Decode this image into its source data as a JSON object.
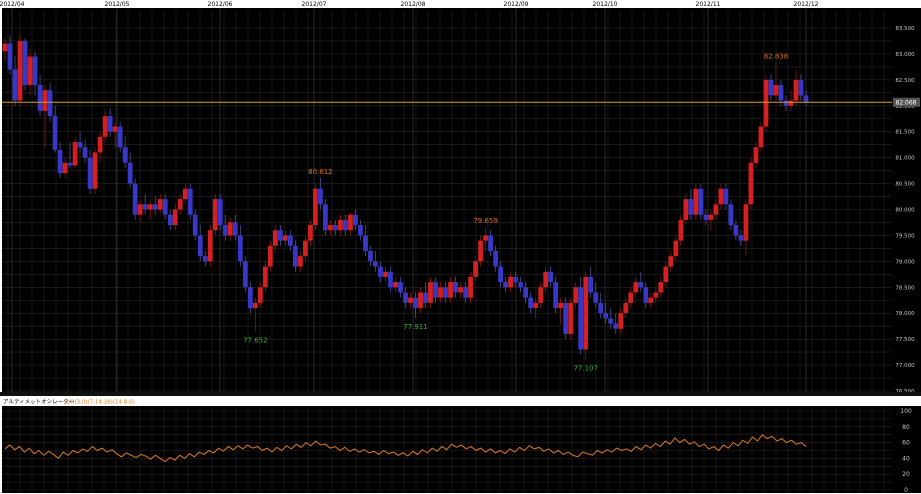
{
  "chart_data": [
    {
      "type": "candlestick",
      "x_labels": [
        "2012/04",
        "2012/05",
        "2012/06",
        "2012/07",
        "2012/08",
        "2012/09",
        "2012/10",
        "2012/11",
        "2012/12"
      ],
      "y_ticks": [
        "83.500",
        "83.000",
        "82.500",
        "82.000",
        "81.500",
        "81.000",
        "80.500",
        "80.000",
        "79.500",
        "79.000",
        "78.500",
        "78.000",
        "77.500",
        "77.000",
        "76.500"
      ],
      "ylim": [
        76.5,
        83.5
      ],
      "current_price": 82.068,
      "current_price_label": "82.068",
      "up_color": "#d42020",
      "down_color": "#3838c8",
      "line_color": "#d8a020",
      "annotations": [
        {
          "label": "77.652",
          "value": 77.652,
          "kind": "low",
          "color": "#30b030"
        },
        {
          "label": "80.612",
          "value": 80.612,
          "kind": "high",
          "color": "#e07020"
        },
        {
          "label": "77.911",
          "value": 77.911,
          "kind": "low",
          "color": "#30b030"
        },
        {
          "label": "79.659",
          "value": 79.659,
          "kind": "high",
          "color": "#e07020"
        },
        {
          "label": "77.107",
          "value": 77.107,
          "kind": "low",
          "color": "#30b030"
        },
        {
          "label": "82.838",
          "value": 82.838,
          "kind": "high",
          "color": "#e07020"
        }
      ],
      "candles": [
        [
          83.05,
          83.3,
          82.85,
          83.2
        ],
        [
          83.2,
          83.35,
          82.6,
          82.7
        ],
        [
          82.7,
          82.95,
          82.0,
          82.1
        ],
        [
          82.1,
          83.4,
          82.0,
          83.25
        ],
        [
          83.25,
          83.3,
          82.3,
          82.4
        ],
        [
          82.4,
          83.1,
          82.2,
          82.95
        ],
        [
          82.95,
          83.05,
          82.2,
          82.4
        ],
        [
          82.4,
          82.6,
          81.8,
          81.9
        ],
        [
          81.9,
          82.4,
          81.2,
          82.3
        ],
        [
          82.3,
          82.45,
          81.7,
          81.8
        ],
        [
          81.8,
          82.0,
          81.1,
          81.15
        ],
        [
          81.15,
          81.3,
          80.6,
          80.7
        ],
        [
          80.7,
          81.0,
          80.6,
          80.9
        ],
        [
          80.9,
          81.3,
          80.8,
          80.85
        ],
        [
          80.85,
          81.4,
          80.8,
          81.3
        ],
        [
          81.3,
          81.5,
          81.1,
          81.2
        ],
        [
          81.2,
          81.35,
          80.9,
          81.0
        ],
        [
          81.0,
          81.15,
          80.3,
          80.4
        ],
        [
          80.4,
          81.2,
          80.3,
          81.1
        ],
        [
          81.1,
          81.5,
          80.9,
          81.4
        ],
        [
          81.4,
          81.9,
          81.3,
          81.8
        ],
        [
          81.8,
          81.95,
          81.4,
          81.5
        ],
        [
          81.5,
          81.7,
          81.2,
          81.6
        ],
        [
          81.6,
          81.7,
          81.1,
          81.2
        ],
        [
          81.2,
          81.4,
          80.8,
          80.9
        ],
        [
          80.9,
          81.1,
          80.4,
          80.5
        ],
        [
          80.5,
          80.6,
          79.8,
          79.9
        ],
        [
          79.9,
          80.2,
          79.75,
          80.1
        ],
        [
          80.1,
          80.3,
          79.9,
          80.0
        ],
        [
          80.0,
          80.2,
          79.8,
          80.1
        ],
        [
          80.1,
          80.25,
          79.9,
          80.0
        ],
        [
          80.0,
          80.3,
          79.9,
          80.2
        ],
        [
          80.2,
          80.3,
          79.8,
          79.9
        ],
        [
          79.9,
          80.0,
          79.6,
          79.7
        ],
        [
          79.7,
          80.1,
          79.6,
          80.0
        ],
        [
          80.0,
          80.3,
          79.9,
          80.2
        ],
        [
          80.2,
          80.5,
          80.1,
          80.4
        ],
        [
          80.4,
          80.5,
          79.8,
          79.9
        ],
        [
          79.9,
          80.0,
          79.4,
          79.5
        ],
        [
          79.5,
          79.7,
          79.0,
          79.1
        ],
        [
          79.1,
          79.2,
          78.9,
          79.0
        ],
        [
          79.0,
          79.7,
          78.9,
          79.6
        ],
        [
          79.6,
          80.3,
          79.5,
          80.2
        ],
        [
          80.2,
          80.3,
          79.6,
          79.7
        ],
        [
          79.7,
          79.9,
          79.4,
          79.5
        ],
        [
          79.5,
          79.85,
          79.4,
          79.75
        ],
        [
          79.75,
          79.9,
          79.4,
          79.5
        ],
        [
          79.5,
          79.7,
          78.9,
          79.0
        ],
        [
          79.0,
          79.1,
          78.4,
          78.5
        ],
        [
          78.5,
          78.6,
          78.0,
          78.1
        ],
        [
          78.1,
          78.3,
          77.65,
          78.2
        ],
        [
          78.2,
          78.6,
          78.1,
          78.5
        ],
        [
          78.5,
          79.0,
          78.4,
          78.9
        ],
        [
          78.9,
          79.4,
          78.8,
          79.3
        ],
        [
          79.3,
          79.7,
          79.2,
          79.6
        ],
        [
          79.6,
          79.7,
          79.3,
          79.4
        ],
        [
          79.4,
          79.6,
          79.3,
          79.5
        ],
        [
          79.5,
          79.6,
          79.2,
          79.3
        ],
        [
          79.3,
          79.4,
          78.8,
          78.9
        ],
        [
          78.9,
          79.2,
          78.8,
          79.1
        ],
        [
          79.1,
          79.5,
          79.0,
          79.4
        ],
        [
          79.4,
          79.8,
          79.3,
          79.7
        ],
        [
          79.7,
          80.5,
          79.6,
          80.4
        ],
        [
          80.4,
          80.61,
          80.0,
          80.1
        ],
        [
          80.1,
          80.2,
          79.5,
          79.6
        ],
        [
          79.6,
          79.8,
          79.5,
          79.7
        ],
        [
          79.7,
          79.8,
          79.5,
          79.6
        ],
        [
          79.6,
          79.9,
          79.5,
          79.8
        ],
        [
          79.8,
          79.9,
          79.5,
          79.6
        ],
        [
          79.6,
          79.95,
          79.5,
          79.9
        ],
        [
          79.9,
          80.0,
          79.6,
          79.7
        ],
        [
          79.7,
          79.8,
          79.4,
          79.5
        ],
        [
          79.5,
          79.7,
          79.1,
          79.2
        ],
        [
          79.2,
          79.3,
          78.9,
          79.0
        ],
        [
          79.0,
          79.2,
          78.8,
          78.9
        ],
        [
          78.9,
          79.0,
          78.6,
          78.7
        ],
        [
          78.7,
          78.9,
          78.6,
          78.8
        ],
        [
          78.8,
          78.9,
          78.4,
          78.5
        ],
        [
          78.5,
          78.7,
          78.4,
          78.6
        ],
        [
          78.6,
          78.7,
          78.3,
          78.4
        ],
        [
          78.4,
          78.5,
          78.1,
          78.2
        ],
        [
          78.2,
          78.4,
          78.1,
          78.3
        ],
        [
          78.3,
          78.4,
          77.91,
          78.1
        ],
        [
          78.1,
          78.5,
          78.0,
          78.4
        ],
        [
          78.4,
          78.6,
          78.1,
          78.2
        ],
        [
          78.2,
          78.7,
          78.1,
          78.6
        ],
        [
          78.6,
          78.7,
          78.2,
          78.3
        ],
        [
          78.3,
          78.6,
          78.2,
          78.5
        ],
        [
          78.5,
          78.6,
          78.2,
          78.3
        ],
        [
          78.3,
          78.7,
          78.2,
          78.6
        ],
        [
          78.6,
          78.7,
          78.3,
          78.4
        ],
        [
          78.4,
          78.6,
          78.3,
          78.5
        ],
        [
          78.5,
          78.6,
          78.2,
          78.3
        ],
        [
          78.3,
          78.8,
          78.2,
          78.7
        ],
        [
          78.7,
          79.1,
          78.6,
          79.0
        ],
        [
          79.0,
          79.5,
          78.9,
          79.4
        ],
        [
          79.4,
          79.66,
          79.2,
          79.5
        ],
        [
          79.5,
          79.6,
          79.1,
          79.2
        ],
        [
          79.2,
          79.3,
          78.8,
          78.9
        ],
        [
          78.9,
          79.0,
          78.5,
          78.6
        ],
        [
          78.6,
          78.7,
          78.4,
          78.5
        ],
        [
          78.5,
          78.8,
          78.4,
          78.7
        ],
        [
          78.7,
          78.8,
          78.5,
          78.6
        ],
        [
          78.6,
          78.7,
          78.4,
          78.5
        ],
        [
          78.5,
          78.6,
          78.2,
          78.3
        ],
        [
          78.3,
          78.4,
          78.0,
          78.1
        ],
        [
          78.1,
          78.3,
          77.9,
          78.2
        ],
        [
          78.2,
          78.6,
          78.1,
          78.5
        ],
        [
          78.5,
          78.9,
          78.4,
          78.8
        ],
        [
          78.8,
          78.9,
          78.5,
          78.6
        ],
        [
          78.6,
          78.7,
          78.0,
          78.1
        ],
        [
          78.1,
          78.3,
          77.8,
          78.2
        ],
        [
          78.2,
          78.3,
          77.5,
          77.6
        ],
        [
          77.6,
          78.3,
          77.5,
          78.2
        ],
        [
          78.2,
          78.6,
          78.1,
          78.5
        ],
        [
          78.5,
          78.7,
          77.2,
          77.3
        ],
        [
          77.3,
          78.8,
          77.11,
          78.7
        ],
        [
          78.7,
          78.9,
          78.3,
          78.4
        ],
        [
          78.4,
          78.6,
          78.1,
          78.2
        ],
        [
          78.2,
          78.4,
          77.9,
          78.0
        ],
        [
          78.0,
          78.2,
          77.8,
          77.9
        ],
        [
          77.9,
          78.1,
          77.7,
          77.8
        ],
        [
          77.8,
          78.0,
          77.6,
          77.7
        ],
        [
          77.7,
          78.1,
          77.6,
          78.0
        ],
        [
          78.0,
          78.3,
          77.9,
          78.2
        ],
        [
          78.2,
          78.5,
          78.1,
          78.4
        ],
        [
          78.4,
          78.7,
          78.3,
          78.6
        ],
        [
          78.6,
          78.8,
          78.4,
          78.5
        ],
        [
          78.5,
          78.6,
          78.1,
          78.2
        ],
        [
          78.2,
          78.4,
          78.1,
          78.3
        ],
        [
          78.3,
          78.5,
          78.2,
          78.4
        ],
        [
          78.4,
          78.7,
          78.3,
          78.6
        ],
        [
          78.6,
          79.0,
          78.5,
          78.9
        ],
        [
          78.9,
          79.2,
          78.8,
          79.1
        ],
        [
          79.1,
          79.5,
          79.0,
          79.4
        ],
        [
          79.4,
          79.9,
          79.3,
          79.8
        ],
        [
          79.8,
          80.3,
          79.7,
          80.2
        ],
        [
          80.2,
          80.4,
          79.8,
          79.9
        ],
        [
          79.9,
          80.5,
          79.8,
          80.4
        ],
        [
          80.4,
          80.5,
          79.8,
          79.9
        ],
        [
          79.9,
          80.0,
          79.7,
          79.8
        ],
        [
          79.8,
          80.0,
          79.6,
          79.9
        ],
        [
          79.9,
          80.2,
          79.8,
          80.1
        ],
        [
          80.1,
          80.5,
          80.0,
          80.4
        ],
        [
          80.4,
          80.5,
          80.0,
          80.1
        ],
        [
          80.1,
          80.2,
          79.6,
          79.7
        ],
        [
          79.7,
          79.8,
          79.4,
          79.5
        ],
        [
          79.5,
          79.6,
          79.3,
          79.4
        ],
        [
          79.4,
          80.2,
          79.1,
          80.1
        ],
        [
          80.1,
          81.0,
          80.0,
          80.9
        ],
        [
          80.9,
          81.3,
          80.8,
          81.2
        ],
        [
          81.2,
          81.7,
          81.1,
          81.6
        ],
        [
          81.6,
          82.6,
          81.5,
          82.5
        ],
        [
          82.5,
          82.6,
          82.1,
          82.2
        ],
        [
          82.2,
          82.84,
          82.1,
          82.4
        ],
        [
          82.4,
          82.5,
          82.0,
          82.1
        ],
        [
          82.1,
          82.2,
          81.9,
          82.0
        ],
        [
          82.0,
          82.3,
          81.9,
          82.1
        ],
        [
          82.1,
          82.7,
          82.0,
          82.5
        ],
        [
          82.5,
          82.6,
          82.1,
          82.2
        ],
        [
          82.2,
          82.3,
          82.0,
          82.07
        ]
      ]
    },
    {
      "type": "line",
      "title": "アルティメットオシレーター",
      "params": "UO(3,0)(7:14:28)(14:8:0)",
      "y_ticks": [
        "100",
        "80",
        "60",
        "40",
        "20",
        "0"
      ],
      "ylim": [
        0,
        100
      ],
      "line_color": "#e07a1e",
      "values": [
        52,
        57,
        51,
        55,
        48,
        53,
        46,
        50,
        44,
        49,
        45,
        40,
        48,
        44,
        50,
        47,
        52,
        49,
        55,
        50,
        53,
        48,
        51,
        46,
        42,
        47,
        44,
        41,
        45,
        43,
        39,
        44,
        40,
        36,
        41,
        38,
        44,
        40,
        46,
        42,
        48,
        45,
        50,
        47,
        53,
        49,
        55,
        51,
        56,
        52,
        57,
        53,
        55,
        50,
        53,
        48,
        54,
        50,
        56,
        52,
        58,
        54,
        60,
        56,
        62,
        57,
        58,
        53,
        55,
        50,
        54,
        49,
        52,
        48,
        51,
        47,
        49,
        45,
        50,
        46,
        48,
        44,
        47,
        43,
        49,
        45,
        51,
        47,
        53,
        49,
        55,
        51,
        58,
        54,
        57,
        52,
        55,
        50,
        53,
        48,
        52,
        47,
        50,
        46,
        52,
        48,
        54,
        50,
        56,
        52,
        54,
        49,
        52,
        47,
        50,
        45,
        48,
        44,
        42,
        48,
        46,
        44,
        50,
        47,
        51,
        48,
        53,
        50,
        52,
        49,
        55,
        51,
        57,
        53,
        59,
        55,
        62,
        58,
        66,
        60,
        64,
        58,
        61,
        55,
        58,
        52,
        55,
        50,
        57,
        53,
        60,
        56,
        63,
        59,
        67,
        62,
        70,
        65,
        68,
        62,
        65,
        60,
        63,
        58,
        60,
        55
      ]
    }
  ]
}
